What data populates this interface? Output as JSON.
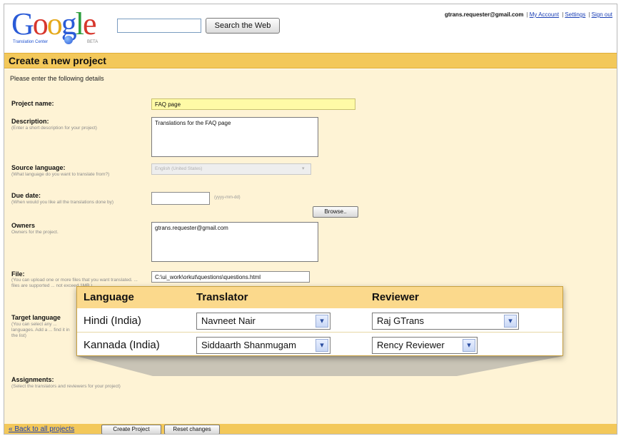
{
  "header": {
    "logo_text": "Google",
    "logo_subtitle": "Translation Center",
    "logo_beta": "BETA",
    "search_value": "",
    "search_button": "Search the Web",
    "user_email": "gtrans.requester@gmail.com",
    "links": [
      "My Account",
      "Settings",
      "Sign out"
    ]
  },
  "page": {
    "title": "Create a new project",
    "intro": "Please enter the following details"
  },
  "form": {
    "project_name": {
      "label": "Project name:",
      "value": "FAQ page"
    },
    "description": {
      "label": "Description:",
      "hint": "(Enter a short description for your project)",
      "value": "Translations for the FAQ page"
    },
    "source_language": {
      "label": "Source language:",
      "hint": "(What language do you want to translate from?)",
      "value": "English (United States)"
    },
    "due_date": {
      "label": "Due date:",
      "hint": "(When would you like all the translations done by)",
      "value": "",
      "format_hint": "(yyyy-mm-dd)"
    },
    "owners": {
      "label": "Owners",
      "hint": "Owners for the project.",
      "value": "gtrans.requester@gmail.com"
    },
    "file": {
      "label": "File:",
      "hint": "(You can upload one or more files that you want translated. ... files are supported ... not exceed 1MB.)",
      "value": "C:\\ui_work\\orkut\\questions\\questions.html",
      "browse_button": "Browse.."
    },
    "target_language": {
      "label": "Target language",
      "hint": "(You can select any ... languages. Add a ... find it in the list)"
    },
    "assignments": {
      "label": "Assignments:",
      "hint": "(Select the translators and reviewers for your project)"
    }
  },
  "assignments_table": {
    "headers": [
      "Language",
      "Translator",
      "Reviewer"
    ],
    "rows": [
      {
        "language": "Hindi (India)",
        "translator": "Navneet Nair",
        "reviewer": "Raj GTrans"
      },
      {
        "language": "Kannada (India)",
        "translator": "Siddaarth Shanmugam",
        "reviewer": "Rency Reviewer"
      }
    ]
  },
  "footer": {
    "back_link": "« Back to all projects",
    "create_button": "Create Project",
    "reset_button": "Reset changes"
  },
  "colors": {
    "accent": "#f3c85a",
    "background": "#fef3d5",
    "link": "#1a3fb5"
  }
}
